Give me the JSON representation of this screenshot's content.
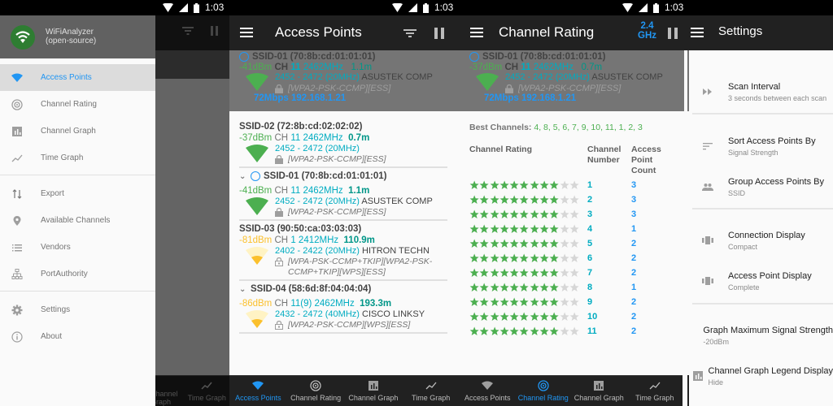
{
  "status_bar": {
    "time": "1:03"
  },
  "icons": {
    "wifi": "wifi-icon",
    "signal": "cell-signal-icon",
    "battery": "battery-icon",
    "menu": "hamburger-menu-icon",
    "filter": "filter-icon",
    "pause": "pause-icon",
    "smile": "connected-smiley-icon",
    "lock": "lock-icon",
    "chevron": "chevron-down-icon"
  },
  "drawer": {
    "app_name": "WiFiAnalyzer",
    "app_subtitle": "(open-source)",
    "items": [
      {
        "label": "Access Points",
        "icon": "wifi-icon",
        "active": true
      },
      {
        "label": "Channel Rating",
        "icon": "radar-icon"
      },
      {
        "label": "Channel Graph",
        "icon": "bar-chart-icon"
      },
      {
        "label": "Time Graph",
        "icon": "line-chart-icon"
      },
      {
        "label": "Export",
        "icon": "swap-vertical-icon"
      },
      {
        "label": "Available Channels",
        "icon": "location-pin-icon"
      },
      {
        "label": "Vendors",
        "icon": "list-icon"
      },
      {
        "label": "PortAuthority",
        "icon": "network-icon"
      },
      {
        "label": "Settings",
        "icon": "gear-icon"
      },
      {
        "label": "About",
        "icon": "info-icon"
      }
    ]
  },
  "bottom_nav": {
    "tabs": [
      "Access Points",
      "Channel Rating",
      "Channel Graph",
      "Time Graph"
    ]
  },
  "access_points_screen": {
    "title": "Access Points",
    "connected": {
      "ssid": "SSID-01 (70:8b:cd:01:01:01)",
      "level": "-41dBm",
      "ch_label": "CH",
      "channel": "11",
      "freq": "2462MHz",
      "distance": "1.1m",
      "range": "2452 - 2472 (20MHz)",
      "vendor": "ASUSTEK COMP",
      "security": "[WPA2-PSK-CCMP][ESS]",
      "speed_ip": "72Mbps 192.168.1.21"
    },
    "list": [
      {
        "ssid": "SSID-02 (72:8b:cd:02:02:02)",
        "level": "-37dBm",
        "channel": "11",
        "freq": "2462MHz",
        "distance": "0.7m",
        "range": "2452 - 2472 (20MHz)",
        "vendor": "",
        "security": "[WPA2-PSK-CCMP][ESS]",
        "strength": "strong",
        "expandable": false,
        "connected": false
      },
      {
        "ssid": "SSID-01 (70:8b:cd:01:01:01)",
        "level": "-41dBm",
        "channel": "11",
        "freq": "2462MHz",
        "distance": "1.1m",
        "range": "2452 - 2472 (20MHz)",
        "vendor": "ASUSTEK COMP",
        "security": "[WPA2-PSK-CCMP][ESS]",
        "strength": "strong",
        "expandable": true,
        "connected": true
      },
      {
        "ssid": "SSID-03 (90:50:ca:03:03:03)",
        "level": "-81dBm",
        "channel": "1",
        "freq": "2412MHz",
        "distance": "110.9m",
        "range": "2402 - 2422 (20MHz)",
        "vendor": "HITRON TECHN",
        "security": "[WPA-PSK-CCMP+TKIP][WPA2-PSK-",
        "security2": "CCMP+TKIP][WPS][ESS]",
        "strength": "weak",
        "expandable": false,
        "connected": false
      },
      {
        "ssid": "SSID-04 (58:6d:8f:04:04:04)",
        "level": "-86dBm",
        "channel": "11(9)",
        "freq": "2462MHz",
        "distance": "193.3m",
        "range": "2432 - 2472 (40MHz)",
        "vendor": "CISCO LINKSY",
        "security": "[WPA2-PSK-CCMP][WPS][ESS]",
        "strength": "weak",
        "expandable": true,
        "connected": false
      }
    ]
  },
  "channel_rating_screen": {
    "title": "Channel Rating",
    "band_line1": "2.4",
    "band_line2": "GHz",
    "connected": {
      "ssid": "SSID-01 (70:8b:cd:01:01:01)",
      "level": "-37dBm",
      "ch_label": "CH",
      "channel": "11",
      "freq": "2462MHz",
      "distance": "0.7m",
      "range": "2452 - 2472 (20MHz)",
      "vendor": "ASUSTEK COMP",
      "security": "[WPA2-PSK-CCMP][ESS]",
      "speed_ip": "72Mbps 192.168.1.21"
    },
    "best_channels_label": "Best Channels:",
    "best_channels": "4, 8, 5, 6, 7, 9, 10, 11, 1, 2, 3",
    "headers": {
      "rating": "Channel Rating",
      "channel": [
        "Channel",
        "Number"
      ],
      "count": [
        "Access",
        "Point",
        "Count"
      ]
    },
    "max_stars": 11,
    "rows": [
      {
        "stars": 9,
        "channel": "1",
        "count": "3"
      },
      {
        "stars": 9,
        "channel": "2",
        "count": "3"
      },
      {
        "stars": 9,
        "channel": "3",
        "count": "3"
      },
      {
        "stars": 9,
        "channel": "4",
        "count": "1"
      },
      {
        "stars": 9,
        "channel": "5",
        "count": "2"
      },
      {
        "stars": 9,
        "channel": "6",
        "count": "2"
      },
      {
        "stars": 9,
        "channel": "7",
        "count": "2"
      },
      {
        "stars": 9,
        "channel": "8",
        "count": "1"
      },
      {
        "stars": 9,
        "channel": "9",
        "count": "2"
      },
      {
        "stars": 9,
        "channel": "10",
        "count": "2"
      },
      {
        "stars": 9,
        "channel": "11",
        "count": "2"
      }
    ]
  },
  "settings_screen": {
    "title": "Settings",
    "items": [
      {
        "title": "Scan Interval",
        "subtitle": "3 seconds between each scan",
        "icon": "fast-forward-icon"
      },
      {
        "title": "Sort Access Points By",
        "subtitle": "Signal Strength",
        "icon": "sort-icon"
      },
      {
        "title": "Group Access Points By",
        "subtitle": "SSID",
        "icon": "group-icon"
      },
      {
        "title": "Connection Display",
        "subtitle": "Compact",
        "icon": "view-carousel-icon"
      },
      {
        "title": "Access Point Display",
        "subtitle": "Complete",
        "icon": "view-carousel-icon"
      },
      {
        "title": "Graph Maximum Signal Strength",
        "subtitle": "-20dBm",
        "icon": ""
      },
      {
        "title": "Channel Graph Legend Display",
        "subtitle": "Hide",
        "icon": "bar-chart-icon"
      }
    ]
  },
  "colors": {
    "accent": "#2196f3",
    "green": "#4caf50",
    "teal": "#00acc1",
    "yellow": "#fbc02d",
    "appbar": "#212121",
    "star_on": "#4caf50",
    "star_off": "#d6d6d6"
  }
}
